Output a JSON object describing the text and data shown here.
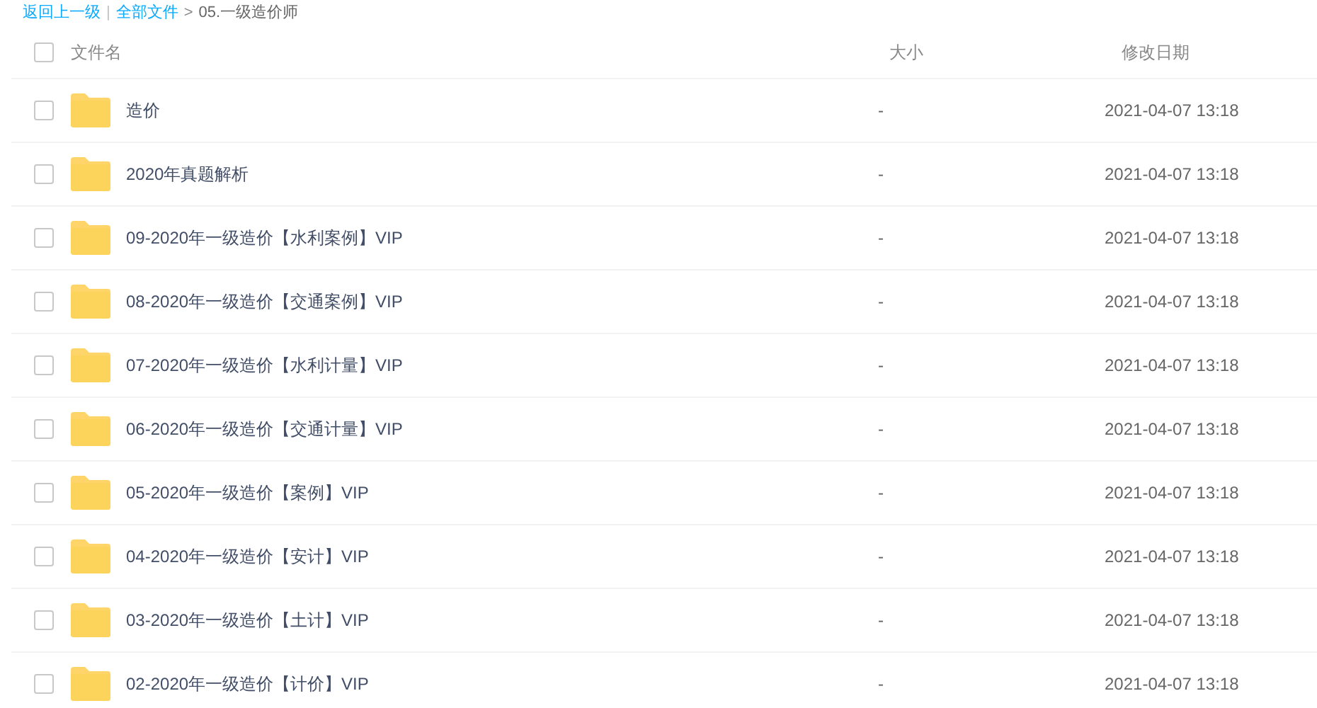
{
  "breadcrumb": {
    "back": "返回上一级",
    "divider": "|",
    "root": "全部文件",
    "separator": ">",
    "current": "05.一级造价师"
  },
  "table": {
    "columns": [
      "文件名",
      "大小",
      "修改日期"
    ],
    "select_all": {
      "checked": false
    },
    "rows": [
      {
        "name": "造价",
        "size": "-",
        "modified": "2021-04-07 13:18",
        "checked": false
      },
      {
        "name": "2020年真题解析",
        "size": "-",
        "modified": "2021-04-07 13:18",
        "checked": false
      },
      {
        "name": "09-2020年一级造价【水利案例】VIP",
        "size": "-",
        "modified": "2021-04-07 13:18",
        "checked": false
      },
      {
        "name": "08-2020年一级造价【交通案例】VIP",
        "size": "-",
        "modified": "2021-04-07 13:18",
        "checked": false
      },
      {
        "name": "07-2020年一级造价【水利计量】VIP",
        "size": "-",
        "modified": "2021-04-07 13:18",
        "checked": false
      },
      {
        "name": "06-2020年一级造价【交通计量】VIP",
        "size": "-",
        "modified": "2021-04-07 13:18",
        "checked": false
      },
      {
        "name": "05-2020年一级造价【案例】VIP",
        "size": "-",
        "modified": "2021-04-07 13:18",
        "checked": false
      },
      {
        "name": "04-2020年一级造价【安计】VIP",
        "size": "-",
        "modified": "2021-04-07 13:18",
        "checked": false
      },
      {
        "name": "03-2020年一级造价【土计】VIP",
        "size": "-",
        "modified": "2021-04-07 13:18",
        "checked": false
      },
      {
        "name": "02-2020年一级造价【计价】VIP",
        "size": "-",
        "modified": "2021-04-07 13:18",
        "checked": false
      }
    ]
  }
}
